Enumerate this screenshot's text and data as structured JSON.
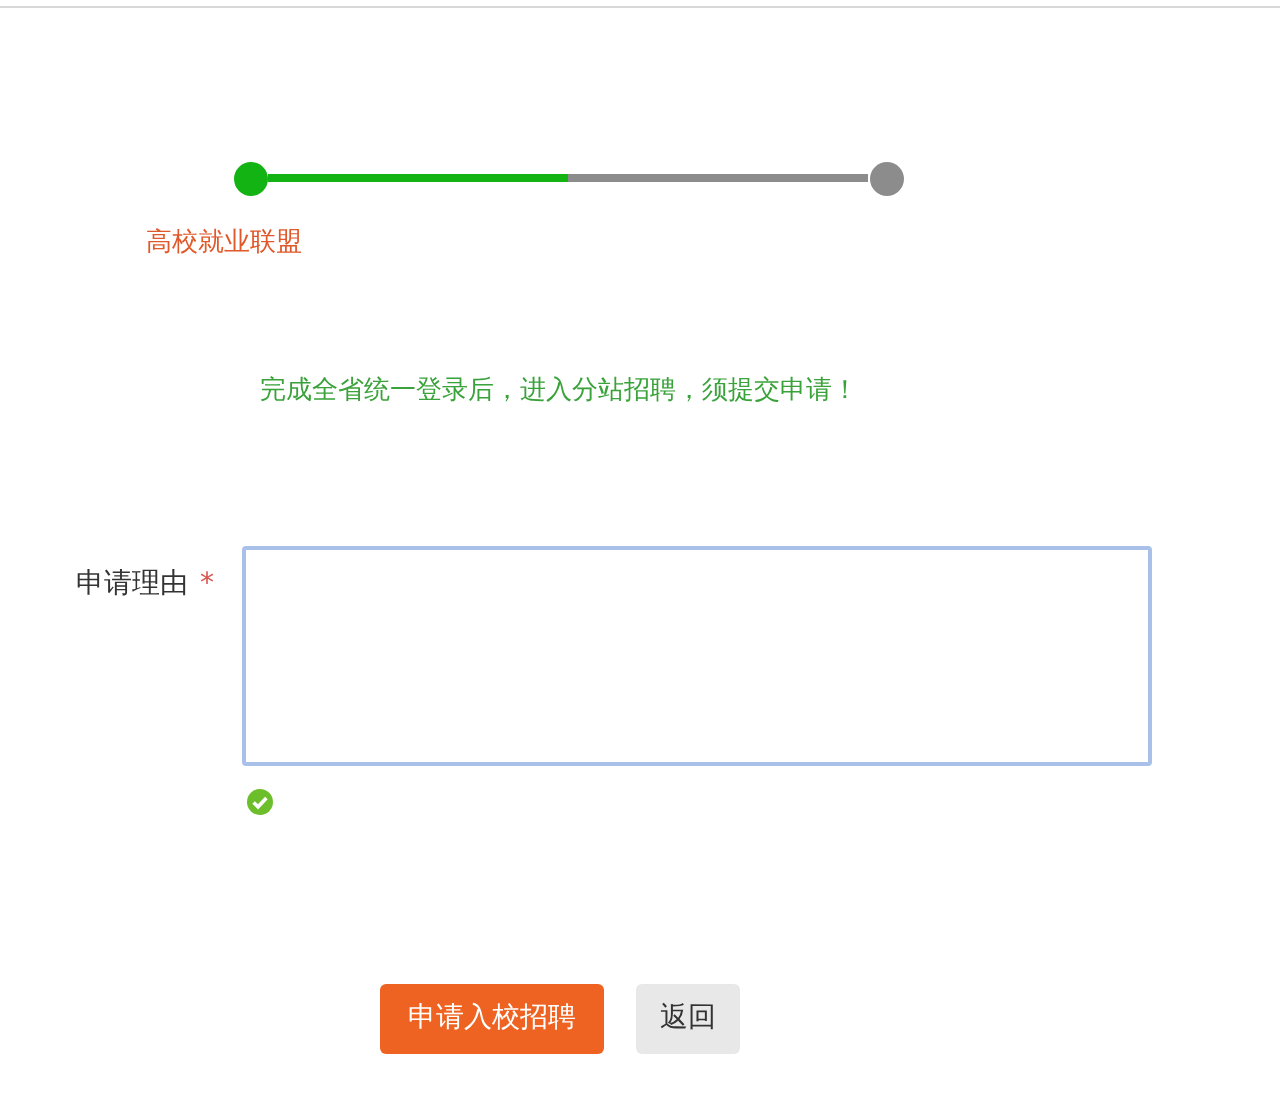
{
  "progress": {
    "level": 0.5,
    "steps": [
      {
        "label": "高校就业联盟",
        "done": true
      },
      {
        "done": false
      }
    ]
  },
  "notice": "完成全省统一登录后，进入分站招聘，须提交申请！",
  "form": {
    "label": "申请理由",
    "required_mark": "*",
    "valid": true
  },
  "buttons": [
    {
      "label": "申请入校招聘",
      "kind": "primary"
    },
    {
      "label": "返回",
      "kind": "secondary"
    }
  ]
}
